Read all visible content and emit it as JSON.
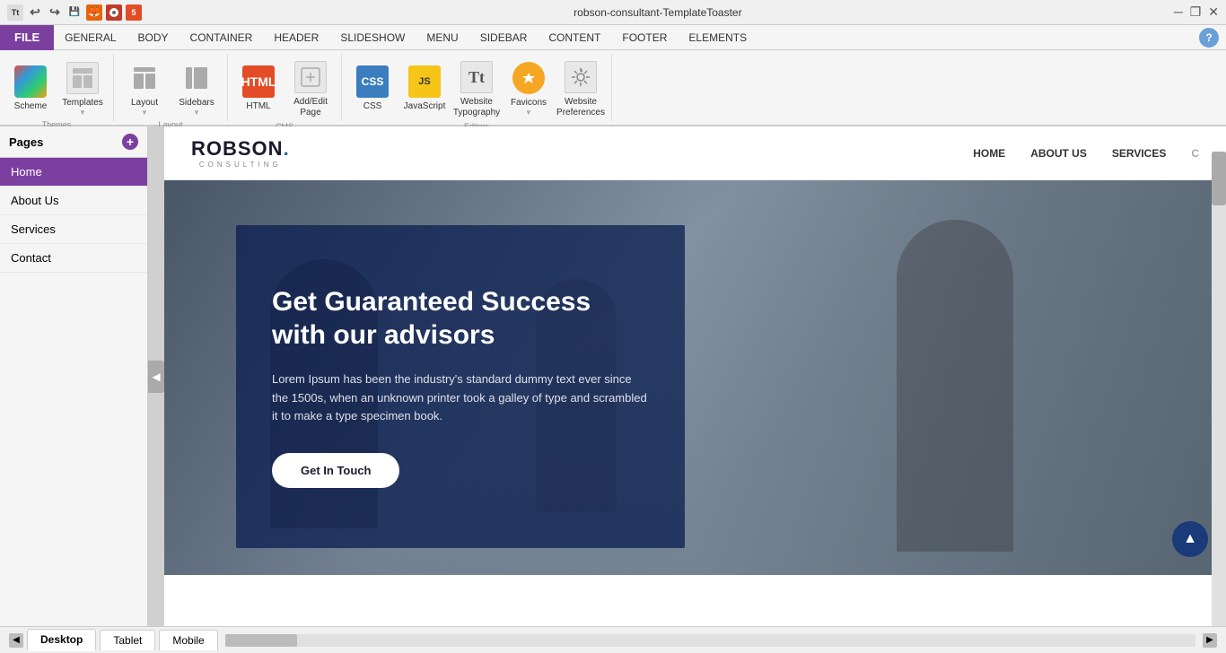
{
  "titlebar": {
    "title": "robson-consultant-TemplateToaster",
    "win_minimize": "─",
    "win_restore": "❐",
    "win_close": "✕"
  },
  "menu_tabs": {
    "file": "FILE",
    "items": [
      "GENERAL",
      "BODY",
      "CONTAINER",
      "HEADER",
      "SLIDESHOW",
      "MENU",
      "SIDEBAR",
      "CONTENT",
      "FOOTER",
      "ELEMENTS"
    ]
  },
  "toolbar": {
    "themes_label": "Themes",
    "layout_label": "Layout",
    "cms_label": "CMS",
    "editors_label": "Editors",
    "tools": [
      {
        "id": "scheme",
        "label": "Scheme"
      },
      {
        "id": "templates",
        "label": "Templates"
      },
      {
        "id": "layout",
        "label": "Layout"
      },
      {
        "id": "sidebars",
        "label": "Sidebars"
      },
      {
        "id": "html",
        "label": "HTML"
      },
      {
        "id": "addedit",
        "label": "Add/Edit Page"
      },
      {
        "id": "css",
        "label": "CSS"
      },
      {
        "id": "javascript",
        "label": "JavaScript"
      },
      {
        "id": "typography",
        "label": "Website Typography"
      },
      {
        "id": "favicons",
        "label": "Favicons"
      },
      {
        "id": "preferences",
        "label": "Website Preferences"
      }
    ]
  },
  "sidebar": {
    "title": "Pages",
    "pages": [
      {
        "label": "Home",
        "active": true
      },
      {
        "label": "About Us",
        "active": false
      },
      {
        "label": "Services",
        "active": false
      },
      {
        "label": "Contact",
        "active": false
      }
    ]
  },
  "site": {
    "logo": "ROBSON.",
    "logo_sub": "CONSULTING",
    "nav_links": [
      "HOME",
      "ABOUT US",
      "SERVICES",
      "C"
    ],
    "hero_title": "Get Guaranteed Success with our advisors",
    "hero_body": "Lorem Ipsum has been the industry's standard dummy text ever since the 1500s, when an unknown printer took a galley of type and scrambled it to make a type specimen book.",
    "hero_btn": "Get In Touch"
  },
  "bottom": {
    "tabs": [
      "Desktop",
      "Tablet",
      "Mobile"
    ]
  }
}
